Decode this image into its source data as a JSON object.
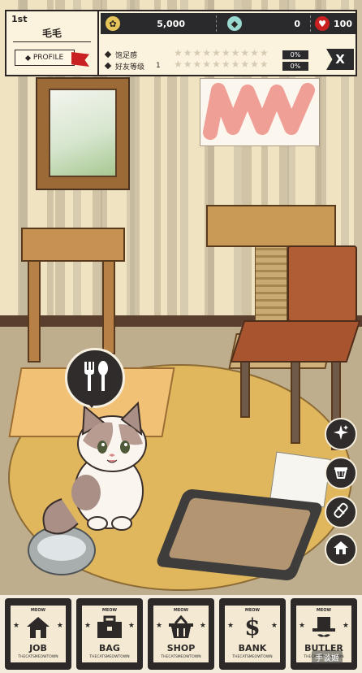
{
  "player": {
    "rank": "1st",
    "name": "毛毛",
    "profile_label": "PROFILE"
  },
  "resources": {
    "coins": "5,000",
    "diamonds": "0",
    "hearts": "100"
  },
  "stats": [
    {
      "label": "饱足感",
      "level": "",
      "stars_filled": 0,
      "stars_total": 10,
      "percent": "0%"
    },
    {
      "label": "好友等级",
      "level": "1",
      "stars_filled": 0,
      "stars_total": 10,
      "percent": "0%"
    }
  ],
  "close_label": "X",
  "nav": [
    {
      "label": "JOB",
      "icon": "house-icon",
      "meow": "MEOW",
      "town": "THECATSMEOWTOWN"
    },
    {
      "label": "BAG",
      "icon": "bag-icon",
      "meow": "MEOW",
      "town": "THECATSMEOWTOWN"
    },
    {
      "label": "SHOP",
      "icon": "basket-icon",
      "meow": "MEOW",
      "town": "THECATSMEOWTOWN"
    },
    {
      "label": "BANK",
      "icon": "dollar-icon",
      "meow": "MEOW",
      "town": "THECATSMEOWTOWN"
    },
    {
      "label": "BUTLER",
      "icon": "top-hat-icon",
      "meow": "MEOW",
      "town": "THECATSMEOWTOWN"
    }
  ],
  "side_buttons": [
    "sparkle-icon",
    "basket-icon",
    "bandage-icon",
    "home-icon"
  ],
  "watermark": "手谈姬",
  "colors": {
    "hud_dark": "#2a2a2c",
    "heart": "#c92121",
    "rug": "#e1b75d",
    "wall": "#efe3c2"
  }
}
